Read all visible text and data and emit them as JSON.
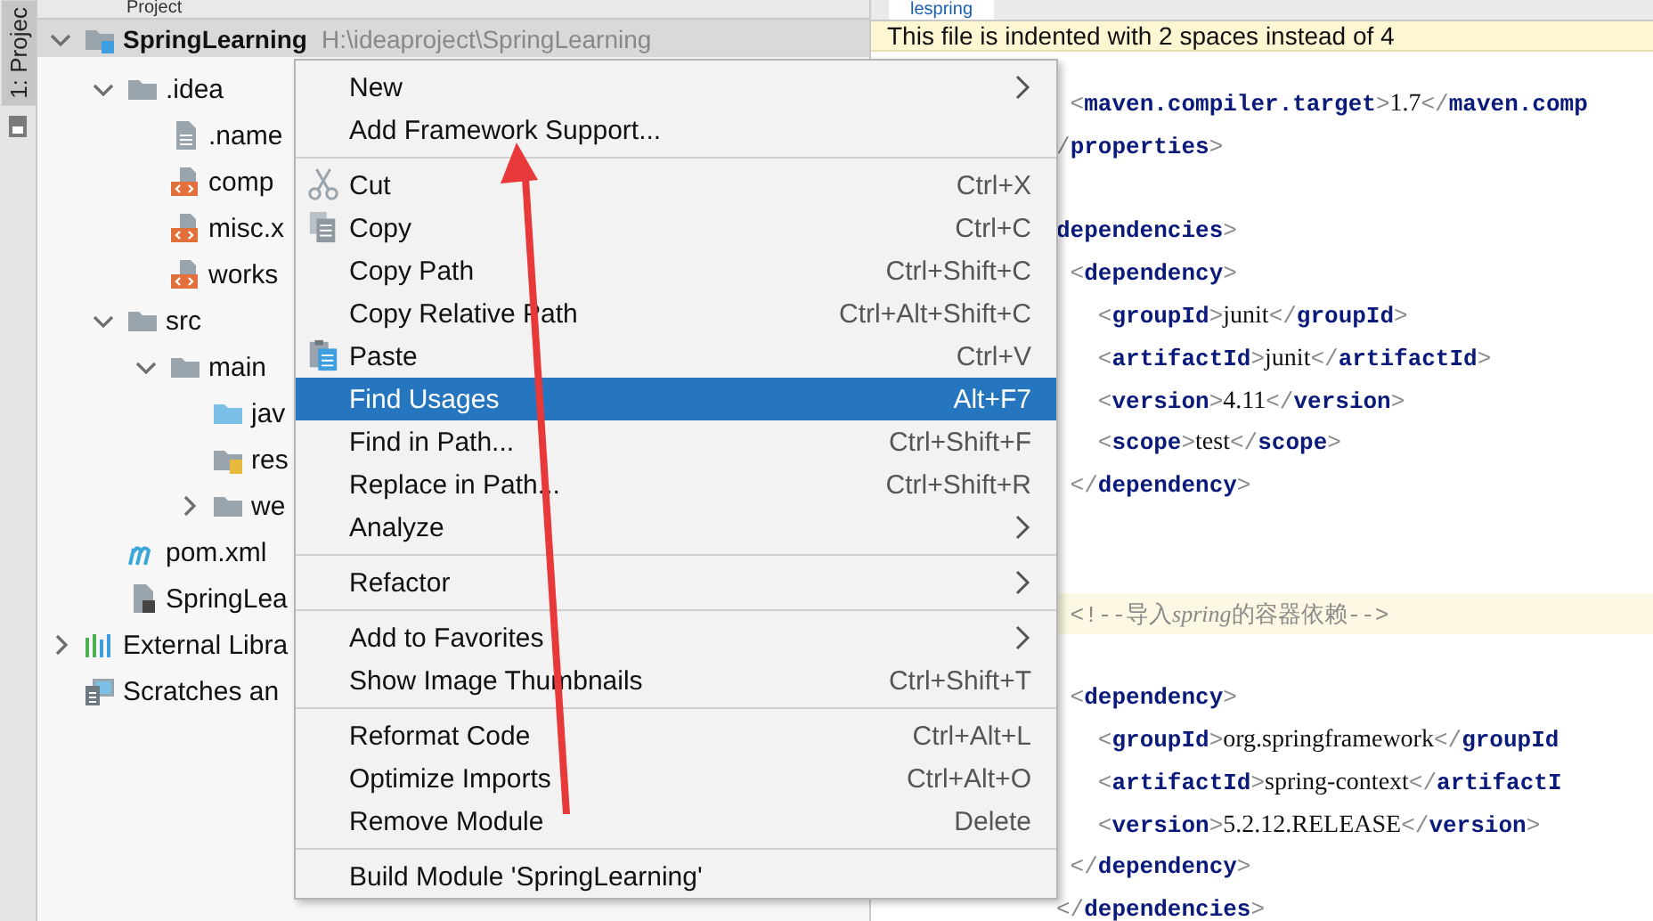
{
  "tool_strip": {
    "tabs": [
      {
        "label": "1: Projec",
        "selected": true
      }
    ]
  },
  "project_panel": {
    "title": "Project",
    "tree": [
      {
        "label": "SpringLearning",
        "path": "H:\\ideaproject\\SpringLearning",
        "kind": "module",
        "expanded": true,
        "selected": true,
        "children": [
          {
            "label": ".idea",
            "kind": "folder",
            "expanded": true,
            "selected": false,
            "children": [
              {
                "label": ".name",
                "kind": "file",
                "selected": false
              },
              {
                "label": "comp",
                "kind": "xml",
                "selected": false
              },
              {
                "label": "misc.x",
                "kind": "xml",
                "selected": false
              },
              {
                "label": "works",
                "kind": "xml",
                "selected": false
              }
            ]
          },
          {
            "label": "src",
            "kind": "folder",
            "expanded": true,
            "selected": false,
            "children": [
              {
                "label": "main",
                "kind": "folder",
                "expanded": true,
                "selected": false,
                "children": [
                  {
                    "label": "jav",
                    "kind": "source-folder",
                    "selected": false
                  },
                  {
                    "label": "res",
                    "kind": "resources-folder",
                    "selected": false
                  },
                  {
                    "label": "we",
                    "kind": "folder",
                    "expanded": false,
                    "selected": false
                  }
                ]
              }
            ]
          },
          {
            "label": "pom.xml",
            "kind": "maven",
            "selected": false
          },
          {
            "label": "SpringLea",
            "kind": "iml",
            "selected": false
          }
        ]
      },
      {
        "label": "External Libra",
        "kind": "library",
        "expanded": false,
        "selected": false
      },
      {
        "label": "Scratches an",
        "kind": "scratches",
        "selected": false
      }
    ]
  },
  "editor": {
    "tab": {
      "label": "lespring"
    },
    "banner": "This file is indented with 2 spaces instead of 4",
    "lines": [
      {
        "kind": "code",
        "segments": [
          {
            "kind": "punct",
            "text": " <"
          },
          {
            "kind": "tag",
            "text": "maven.compiler.target"
          },
          {
            "kind": "punct",
            "text": ">"
          },
          {
            "kind": "value",
            "text": "1.7"
          },
          {
            "kind": "punct",
            "text": "</"
          },
          {
            "kind": "tag",
            "text": "maven.comp"
          }
        ]
      },
      {
        "kind": "code",
        "segments": [
          {
            "kind": "punct",
            "text": "/"
          },
          {
            "kind": "tag",
            "text": "properties"
          },
          {
            "kind": "punct",
            "text": ">"
          }
        ]
      },
      {
        "kind": "blank"
      },
      {
        "kind": "code",
        "segments": [
          {
            "kind": "tag",
            "text": "dependencies"
          },
          {
            "kind": "punct",
            "text": ">"
          }
        ]
      },
      {
        "kind": "code",
        "segments": [
          {
            "kind": "punct",
            "text": " <"
          },
          {
            "kind": "tag",
            "text": "dependency"
          },
          {
            "kind": "punct",
            "text": ">"
          }
        ]
      },
      {
        "kind": "code",
        "segments": [
          {
            "kind": "punct",
            "text": "   <"
          },
          {
            "kind": "tag",
            "text": "groupId"
          },
          {
            "kind": "punct",
            "text": ">"
          },
          {
            "kind": "value",
            "text": "junit"
          },
          {
            "kind": "punct",
            "text": "</"
          },
          {
            "kind": "tag",
            "text": "groupId"
          },
          {
            "kind": "punct",
            "text": ">"
          }
        ]
      },
      {
        "kind": "code",
        "segments": [
          {
            "kind": "punct",
            "text": "   <"
          },
          {
            "kind": "tag",
            "text": "artifactId"
          },
          {
            "kind": "punct",
            "text": ">"
          },
          {
            "kind": "value",
            "text": "junit"
          },
          {
            "kind": "punct",
            "text": "</"
          },
          {
            "kind": "tag",
            "text": "artifactId"
          },
          {
            "kind": "punct",
            "text": ">"
          }
        ]
      },
      {
        "kind": "code",
        "segments": [
          {
            "kind": "punct",
            "text": "   <"
          },
          {
            "kind": "tag",
            "text": "version"
          },
          {
            "kind": "punct",
            "text": ">"
          },
          {
            "kind": "value",
            "text": "4.11"
          },
          {
            "kind": "punct",
            "text": "</"
          },
          {
            "kind": "tag",
            "text": "version"
          },
          {
            "kind": "punct",
            "text": ">"
          }
        ]
      },
      {
        "kind": "code",
        "segments": [
          {
            "kind": "punct",
            "text": "   <"
          },
          {
            "kind": "tag",
            "text": "scope"
          },
          {
            "kind": "punct",
            "text": ">"
          },
          {
            "kind": "value",
            "text": "test"
          },
          {
            "kind": "punct",
            "text": "</"
          },
          {
            "kind": "tag",
            "text": "scope"
          },
          {
            "kind": "punct",
            "text": ">"
          }
        ]
      },
      {
        "kind": "code",
        "segments": [
          {
            "kind": "punct",
            "text": " </"
          },
          {
            "kind": "tag",
            "text": "dependency"
          },
          {
            "kind": "punct",
            "text": ">"
          }
        ]
      },
      {
        "kind": "blank"
      },
      {
        "kind": "blank"
      },
      {
        "kind": "comment",
        "segments": [
          {
            "kind": "plain",
            "text": " <!--导入"
          },
          {
            "kind": "italic",
            "text": "spring"
          },
          {
            "kind": "plain",
            "text": "的容器依赖-->"
          }
        ]
      },
      {
        "kind": "blank"
      },
      {
        "kind": "code",
        "segments": [
          {
            "kind": "punct",
            "text": " <"
          },
          {
            "kind": "tag",
            "text": "dependency"
          },
          {
            "kind": "punct",
            "text": ">"
          }
        ]
      },
      {
        "kind": "code",
        "segments": [
          {
            "kind": "punct",
            "text": "   <"
          },
          {
            "kind": "tag",
            "text": "groupId"
          },
          {
            "kind": "punct",
            "text": ">"
          },
          {
            "kind": "value",
            "text": "org.springframework"
          },
          {
            "kind": "punct",
            "text": "</"
          },
          {
            "kind": "tag",
            "text": "groupId"
          }
        ]
      },
      {
        "kind": "code",
        "segments": [
          {
            "kind": "punct",
            "text": "   <"
          },
          {
            "kind": "tag",
            "text": "artifactId"
          },
          {
            "kind": "punct",
            "text": ">"
          },
          {
            "kind": "value",
            "text": "spring-context"
          },
          {
            "kind": "punct",
            "text": "</"
          },
          {
            "kind": "tag",
            "text": "artifactI"
          }
        ]
      },
      {
        "kind": "code",
        "segments": [
          {
            "kind": "punct",
            "text": "   <"
          },
          {
            "kind": "tag",
            "text": "version"
          },
          {
            "kind": "punct",
            "text": ">"
          },
          {
            "kind": "value",
            "text": "5.2.12.RELEASE"
          },
          {
            "kind": "punct",
            "text": "</"
          },
          {
            "kind": "tag",
            "text": "version"
          },
          {
            "kind": "punct",
            "text": ">"
          }
        ]
      },
      {
        "kind": "code",
        "segments": [
          {
            "kind": "punct",
            "text": " </"
          },
          {
            "kind": "tag",
            "text": "dependency"
          },
          {
            "kind": "punct",
            "text": ">"
          }
        ]
      },
      {
        "kind": "code",
        "segments": [
          {
            "kind": "punct",
            "text": "</"
          },
          {
            "kind": "tag",
            "text": "dependencies"
          },
          {
            "kind": "punct",
            "text": ">"
          }
        ]
      }
    ]
  },
  "context_menu": {
    "items": [
      {
        "kind": "plain",
        "label": "New",
        "submenu": true,
        "selected": false
      },
      {
        "kind": "plain",
        "label": "Add Framework Support...",
        "selected": false
      },
      {
        "kind": "separator"
      },
      {
        "kind": "scissors",
        "label": "Cut",
        "shortcut": "Ctrl+X",
        "selected": false
      },
      {
        "kind": "copy",
        "label": "Copy",
        "shortcut": "Ctrl+C",
        "selected": false
      },
      {
        "kind": "plain",
        "label": "Copy Path",
        "shortcut": "Ctrl+Shift+C",
        "selected": false
      },
      {
        "kind": "plain",
        "label": "Copy Relative Path",
        "shortcut": "Ctrl+Alt+Shift+C",
        "selected": false
      },
      {
        "kind": "paste",
        "label": "Paste",
        "shortcut": "Ctrl+V",
        "selected": false
      },
      {
        "kind": "plain",
        "label": "Find Usages",
        "shortcut": "Alt+F7",
        "selected": true
      },
      {
        "kind": "plain",
        "label": "Find in Path...",
        "shortcut": "Ctrl+Shift+F",
        "selected": false
      },
      {
        "kind": "plain",
        "label": "Replace in Path...",
        "shortcut": "Ctrl+Shift+R",
        "selected": false
      },
      {
        "kind": "plain",
        "label": "Analyze",
        "submenu": true,
        "selected": false
      },
      {
        "kind": "separator"
      },
      {
        "kind": "plain",
        "label": "Refactor",
        "submenu": true,
        "selected": false
      },
      {
        "kind": "separator"
      },
      {
        "kind": "plain",
        "label": "Add to Favorites",
        "submenu": true,
        "selected": false
      },
      {
        "kind": "plain",
        "label": "Show Image Thumbnails",
        "shortcut": "Ctrl+Shift+T",
        "selected": false
      },
      {
        "kind": "separator"
      },
      {
        "kind": "plain",
        "label": "Reformat Code",
        "shortcut": "Ctrl+Alt+L",
        "selected": false
      },
      {
        "kind": "plain",
        "label": "Optimize Imports",
        "shortcut": "Ctrl+Alt+O",
        "selected": false
      },
      {
        "kind": "plain",
        "label": "Remove Module",
        "shortcut": "Delete",
        "selected": false
      },
      {
        "kind": "separator"
      },
      {
        "kind": "plain",
        "label": "Build Module 'SpringLearning'",
        "selected": false
      }
    ]
  }
}
